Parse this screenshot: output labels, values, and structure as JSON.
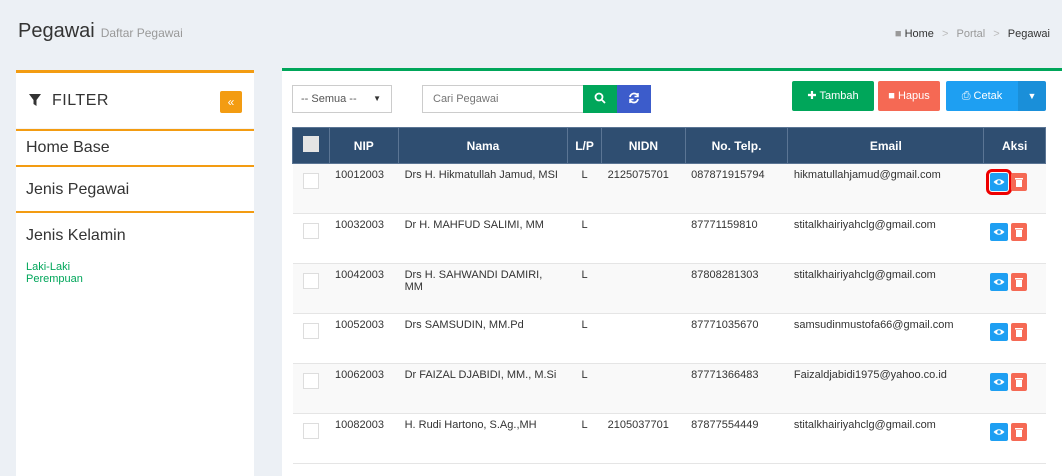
{
  "header": {
    "title": "Pegawai",
    "subtitle": "Daftar Pegawai",
    "breadcrumb": [
      "Home",
      "Portal",
      "Pegawai"
    ]
  },
  "sidebar": {
    "filter_title": "FILTER",
    "collapse_icon": "«",
    "sections": [
      "Home Base",
      "Jenis Pegawai",
      "Jenis Kelamin"
    ],
    "kelamin_options": [
      "Laki-Laki",
      "Perempuan"
    ]
  },
  "toolbar": {
    "select_value": "-- Semua --",
    "search_placeholder": "Cari Pegawai",
    "tambah_label": "Tambah",
    "hapus_label": "Hapus",
    "cetak_label": "Cetak"
  },
  "table": {
    "headers": [
      "NIP",
      "Nama",
      "L/P",
      "NIDN",
      "No. Telp.",
      "Email",
      "Aksi"
    ],
    "rows": [
      {
        "nip": "10012003",
        "nama": "Drs H. Hikmatullah Jamud, MSI",
        "lp": "L",
        "nidn": "2125075701",
        "telp": "087871915794",
        "email": "hikmatullahjamud@gmail.com"
      },
      {
        "nip": "10032003",
        "nama": "Dr H. MAHFUD SALIMI, MM",
        "lp": "L",
        "nidn": "",
        "telp": "87771159810",
        "email": "stitalkhairiyahclg@gmail.com"
      },
      {
        "nip": "10042003",
        "nama": "Drs H. SAHWANDI DAMIRI, MM",
        "lp": "L",
        "nidn": "",
        "telp": "87808281303",
        "email": "stitalkhairiyahclg@gmail.com"
      },
      {
        "nip": "10052003",
        "nama": "Drs SAMSUDIN, MM.Pd",
        "lp": "L",
        "nidn": "",
        "telp": "87771035670",
        "email": "samsudinmustofa66@gmail.com"
      },
      {
        "nip": "10062003",
        "nama": "Dr FAIZAL DJABIDI, MM., M.Si",
        "lp": "L",
        "nidn": "",
        "telp": "87771366483",
        "email": "Faizaldjabidi1975@yahoo.co.id"
      },
      {
        "nip": "10082003",
        "nama": "H. Rudi Hartono, S.Ag.,MH",
        "lp": "L",
        "nidn": "2105037701",
        "telp": "87877554449",
        "email": "stitalkhairiyahclg@gmail.com"
      }
    ]
  },
  "colors": {
    "header_bg": "#2f4e71",
    "green": "#00a65a",
    "orange": "#f39c12",
    "red": "#f56954",
    "blue": "#1e9ff2",
    "highlight": "#ee0000"
  }
}
